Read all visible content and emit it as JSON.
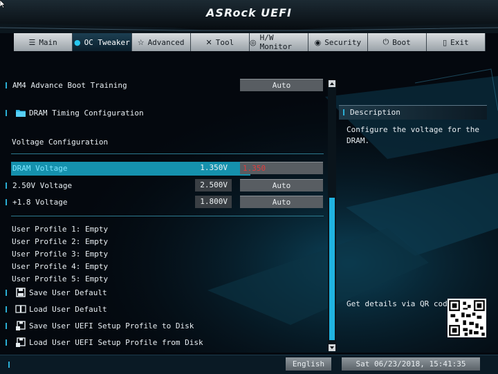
{
  "header": {
    "logo_text": "ASRock UEFI"
  },
  "tabs": [
    {
      "label": "Main",
      "icon": "list-icon"
    },
    {
      "label": "OC Tweaker",
      "icon": "flame-icon"
    },
    {
      "label": "Advanced",
      "icon": "star-icon"
    },
    {
      "label": "Tool",
      "icon": "tools-icon"
    },
    {
      "label": "H/W Monitor",
      "icon": "monitor-icon"
    },
    {
      "label": "Security",
      "icon": "shield-icon"
    },
    {
      "label": "Boot",
      "icon": "power-icon"
    },
    {
      "label": "Exit",
      "icon": "exit-icon"
    }
  ],
  "active_tab": "OC Tweaker",
  "settings": {
    "am4_boot": {
      "label": "AM4 Advance Boot Training",
      "option": "Auto"
    },
    "dram_timing": {
      "label": "DRAM Timing Configuration",
      "icon": "folder-icon"
    },
    "voltage_section": "Voltage Configuration",
    "dram_voltage": {
      "label": "DRAM Voltage",
      "value": "1.350V",
      "option": "1.350"
    },
    "v250": {
      "label": "2.50V Voltage",
      "value": "2.500V",
      "option": "Auto"
    },
    "v18": {
      "label": "+1.8 Voltage",
      "value": "1.800V",
      "option": "Auto"
    },
    "profiles": [
      "User Profile 1: Empty",
      "User Profile 2: Empty",
      "User Profile 3: Empty",
      "User Profile 4: Empty",
      "User Profile 5: Empty"
    ],
    "actions": [
      {
        "label": "Save User Default",
        "icon": "save-icon"
      },
      {
        "label": "Load User Default",
        "icon": "book-icon"
      },
      {
        "label": "Save User UEFI Setup Profile to Disk",
        "icon": "disk-save-icon"
      },
      {
        "label": "Load User UEFI Setup Profile from Disk",
        "icon": "disk-load-icon"
      }
    ]
  },
  "description": {
    "title": "Description",
    "text": "Configure the voltage for the DRAM.",
    "qr_text": "Get details via QR code"
  },
  "footer": {
    "language": "English",
    "datetime": "Sat 06/23/2018, 15:41:35"
  },
  "colors": {
    "accent": "#1591ad",
    "scroll": "#20b3e0",
    "highlight_red": "#e23c3c"
  }
}
